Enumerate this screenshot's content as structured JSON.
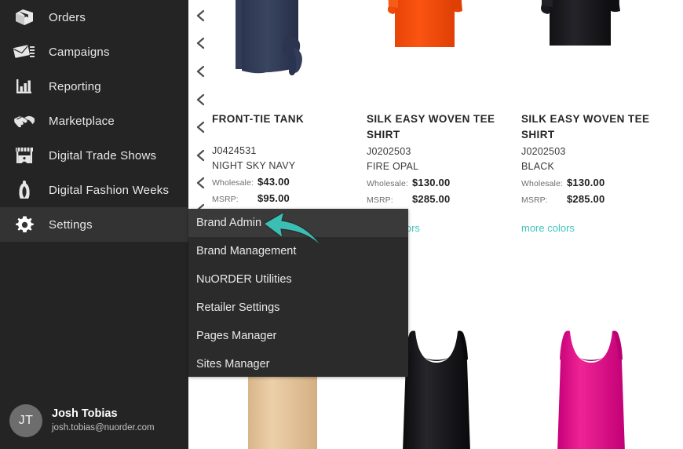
{
  "sidebar": {
    "items": [
      {
        "label": "Orders",
        "icon": "box-icon",
        "active": false
      },
      {
        "label": "Campaigns",
        "icon": "envelope-icon",
        "active": false
      },
      {
        "label": "Reporting",
        "icon": "bar-chart-icon",
        "active": false
      },
      {
        "label": "Marketplace",
        "icon": "handshake-icon",
        "active": false
      },
      {
        "label": "Digital Trade Shows",
        "icon": "market-stall-icon",
        "active": false
      },
      {
        "label": "Digital Fashion Weeks",
        "icon": "dress-form-icon",
        "active": false
      },
      {
        "label": "Settings",
        "icon": "gear-icon",
        "active": true
      }
    ],
    "user": {
      "initials": "JT",
      "name": "Josh Tobias",
      "email": "josh.tobias@nuorder.com"
    },
    "background_color": "#242424",
    "active_color": "#333333"
  },
  "submenu": {
    "items": [
      {
        "label": "Brand Admin",
        "active": true
      },
      {
        "label": "Brand Management",
        "active": false
      },
      {
        "label": "NuORDER Utilities",
        "active": false
      },
      {
        "label": "Retailer Settings",
        "active": false
      },
      {
        "label": "Pages Manager",
        "active": false
      },
      {
        "label": "Sites Manager",
        "active": false
      }
    ],
    "background_color": "#2b2b2b",
    "active_color": "#3a3a3a"
  },
  "annotation": {
    "type": "curved-arrow",
    "points_to": "Brand Admin",
    "color": "#3bbfb4"
  },
  "chevron_rail": {
    "icon": "chevron-left-icon",
    "count": 8,
    "label": "<"
  },
  "content": {
    "more_colors_label": "more colors",
    "accent_color": "#3fc6bd",
    "rows": [
      {
        "products": [
          {
            "name": "FRONT-TIE TANK",
            "sku": "J0424531",
            "color": "NIGHT SKY NAVY",
            "wholesale_label": "Wholesale:",
            "wholesale_value": "$43.00",
            "msrp_label": "MSRP:",
            "msrp_value": "$95.00",
            "swatch": "#2f3a56",
            "garment": "tied-tank",
            "more_colors": true
          },
          {
            "name": "SILK EASY WOVEN TEE SHIRT",
            "sku": "J0202503",
            "color": "FIRE OPAL",
            "wholesale_label": "Wholesale:",
            "wholesale_value": "$130.00",
            "msrp_label": "MSRP:",
            "msrp_value": "$285.00",
            "swatch": "#f04908",
            "garment": "tee",
            "more_colors": true
          },
          {
            "name": "SILK EASY WOVEN TEE SHIRT",
            "sku": "J0202503",
            "color": "BLACK",
            "wholesale_label": "Wholesale:",
            "wholesale_value": "$130.00",
            "msrp_label": "MSRP:",
            "msrp_value": "$285.00",
            "swatch": "#17171a",
            "garment": "tee",
            "more_colors": true
          }
        ]
      },
      {
        "products": [
          {
            "swatch": "#e3c396",
            "garment": "tank"
          },
          {
            "swatch": "#161618",
            "garment": "tank"
          },
          {
            "swatch": "#e51a8c",
            "garment": "tank"
          }
        ]
      }
    ]
  }
}
